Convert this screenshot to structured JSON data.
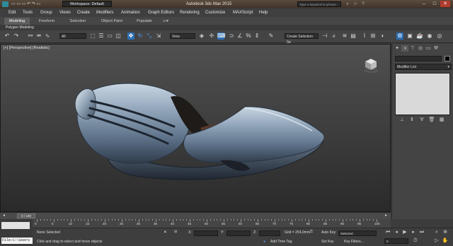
{
  "titlebar": {
    "workspace": "Workspace: Default",
    "title": "Autodesk 3ds Max 2015",
    "search_placeholder": "Type a keyword or phrase",
    "minimize": "–",
    "maximize": "□",
    "close": "✕"
  },
  "menu": [
    "Edit",
    "Tools",
    "Group",
    "Views",
    "Create",
    "Modifiers",
    "Animation",
    "Graph Editors",
    "Rendering",
    "Customize",
    "MAXScript",
    "Help"
  ],
  "ribbon": {
    "tabs": [
      "Modeling",
      "Freeform",
      "Selection",
      "Object Paint",
      "Populate"
    ],
    "active_tab": "Modeling",
    "subtitle": "Polygon Modeling"
  },
  "toolbar": {
    "filter": "All",
    "refcoord": "View",
    "selection_set": "Create Selection Se"
  },
  "viewport": {
    "label": "[+] [Perspective] [Realistic]"
  },
  "timeslider": {
    "position": "0 / 100",
    "current_frame": 0,
    "total_frames": 100
  },
  "trackbar": {
    "ticks": [
      "0",
      "5",
      "10",
      "15",
      "20",
      "25",
      "30",
      "35",
      "40",
      "45",
      "50",
      "55",
      "60",
      "65",
      "70",
      "75",
      "80",
      "85",
      "90",
      "95",
      "100"
    ]
  },
  "status": {
    "maxscript": "File:C:\\Users",
    "selection": "None Selected",
    "prompt": "Click and drag to select and move objects",
    "x_label": "X:",
    "y_label": "Y:",
    "z_label": "Z:",
    "grid": "Grid = 254,0mm",
    "add_time_tag": "Add Time Tag",
    "auto_key": "Auto Key",
    "auto_key_value": "Selected",
    "set_key": "Set Key",
    "key_filters": "Key Filters...",
    "frame": "0"
  },
  "command_panel": {
    "modifier_list": "Modifier List"
  },
  "colors": {
    "accent": "#2d6fb5",
    "titlebar": "#4a3d32",
    "viewport_bg": "#464646"
  }
}
